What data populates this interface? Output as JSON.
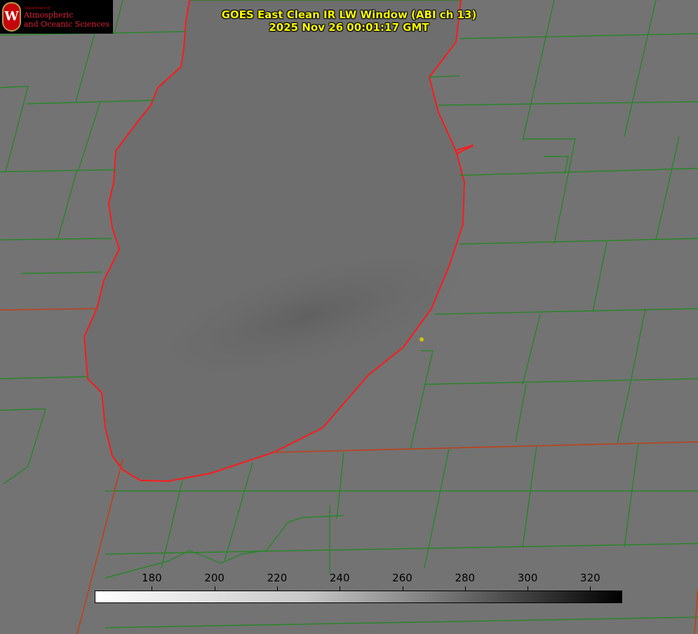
{
  "title": {
    "line1": "GOES East Clean IR LW Window (ABI ch 13)",
    "line2": "2025 Nov 26 00:01:17 GMT"
  },
  "logo": {
    "department": "Department of",
    "line1": "Atmospheric",
    "line2": "and Oceanic Sciences",
    "crest_letter": "W"
  },
  "colorbar": {
    "range": [
      162,
      330
    ],
    "ticks": [
      "180",
      "200",
      "220",
      "240",
      "260",
      "280",
      "300",
      "320"
    ],
    "colormap": "white-to-black"
  },
  "colors": {
    "background": "#717171",
    "county_lines": "#1a8a1a",
    "state_lines": "#d83010",
    "lake_outline": "#ff1a1a",
    "title": "#ffff00",
    "marker": "#d6c200"
  }
}
